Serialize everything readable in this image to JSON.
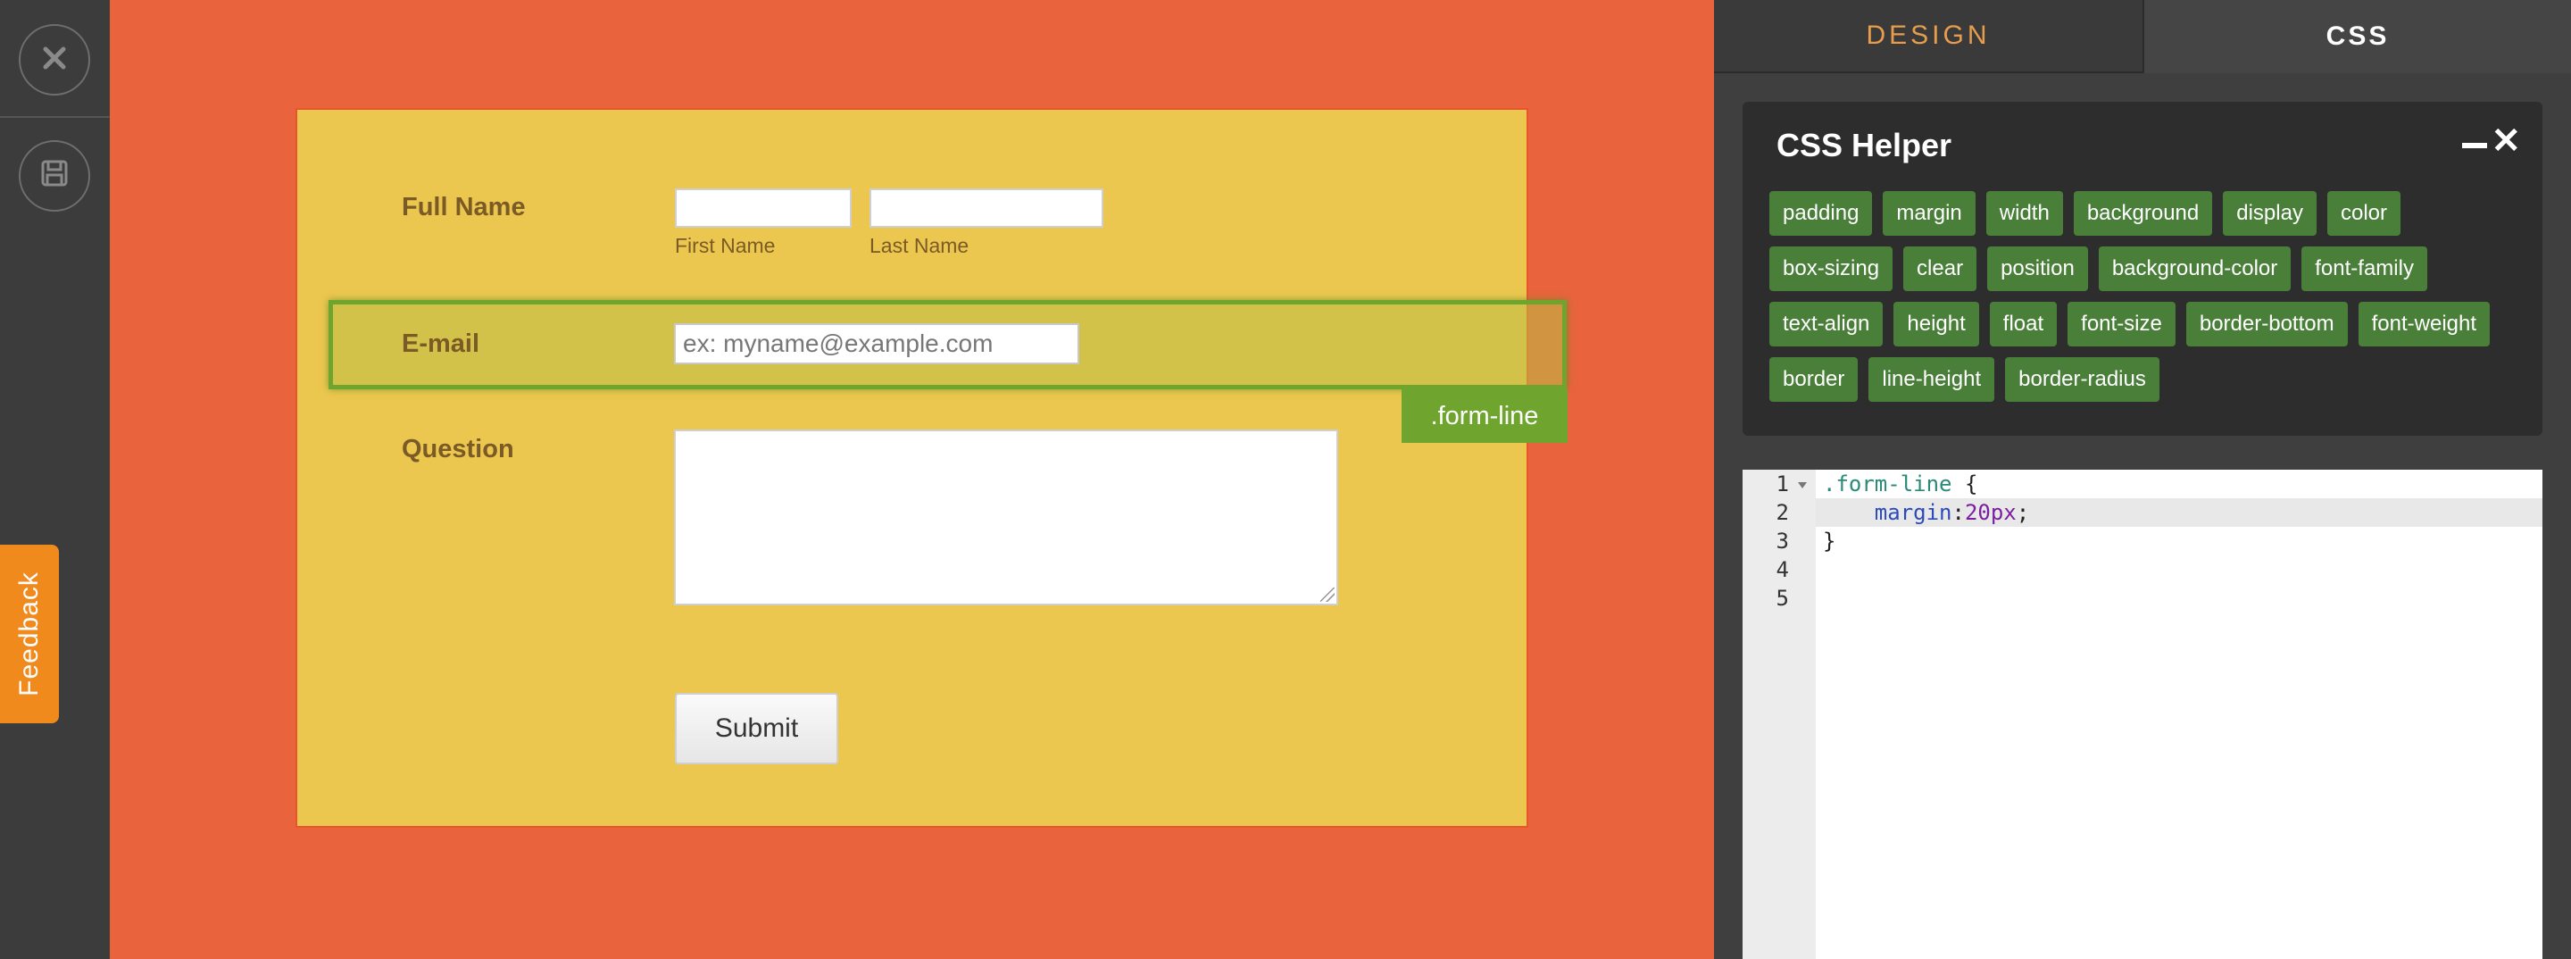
{
  "left_rail": {
    "close_icon": "close-x-icon",
    "save_icon": "floppy-disk-icon",
    "feedback_label": "Feedback"
  },
  "form": {
    "full_name_label": "Full Name",
    "first_name_sublabel": "First Name",
    "last_name_sublabel": "Last Name",
    "email_label": "E-mail",
    "email_placeholder": "ex: myname@example.com",
    "question_label": "Question",
    "submit_label": "Submit",
    "selector_tag": ".form-line"
  },
  "panel": {
    "tabs": [
      {
        "label": "DESIGN",
        "active": false
      },
      {
        "label": "CSS",
        "active": true
      }
    ],
    "helper_title": "CSS Helper",
    "properties": [
      "padding",
      "margin",
      "width",
      "background",
      "display",
      "color",
      "box-sizing",
      "clear",
      "position",
      "background-color",
      "font-family",
      "text-align",
      "height",
      "float",
      "font-size",
      "border-bottom",
      "font-weight",
      "border",
      "line-height",
      "border-radius"
    ],
    "editor": {
      "line_numbers": [
        "1",
        "2",
        "3",
        "4",
        "5"
      ],
      "code": {
        "selector": ".form-line",
        "open_brace": " {",
        "indent": "    ",
        "property": "margin",
        "colon": ":",
        "number": "20",
        "unit": "px",
        "semicolon": ";",
        "close_brace": "}"
      }
    }
  },
  "colors": {
    "canvas_bg": "#e9643d",
    "form_bg": "#ecc750",
    "label_text": "#7a5a25",
    "highlight_border": "#6fa52f",
    "chip_bg": "#4a7f3a",
    "design_tab_text": "#e79d4b",
    "feedback_bg": "#f08a1c"
  }
}
